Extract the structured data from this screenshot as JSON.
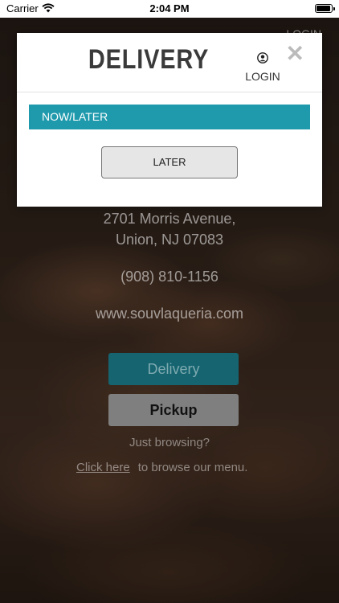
{
  "status_bar": {
    "carrier": "Carrier",
    "time": "2:04 PM"
  },
  "background": {
    "login_label": "LOGIN",
    "address_line1": "2701 Morris Avenue,",
    "address_line2": "Union, NJ 07083",
    "phone": "(908) 810-1156",
    "website": "www.souvlaqueria.com",
    "delivery_label": "Delivery",
    "pickup_label": "Pickup",
    "browsing_text": "Just browsing?",
    "click_here": "Click here",
    "browse_menu_text": "to browse our menu."
  },
  "modal": {
    "title": "DELIVERY",
    "login_label": "LOGIN",
    "close_symbol": "✕",
    "section_label": "NOW/LATER",
    "later_label": "LATER"
  },
  "colors": {
    "accent": "#1f9aad",
    "delivery_button": "#156470",
    "pickup_button": "#7f7f7f"
  },
  "icons": [
    "wifi-icon",
    "battery-icon",
    "user-icon",
    "close-icon"
  ]
}
